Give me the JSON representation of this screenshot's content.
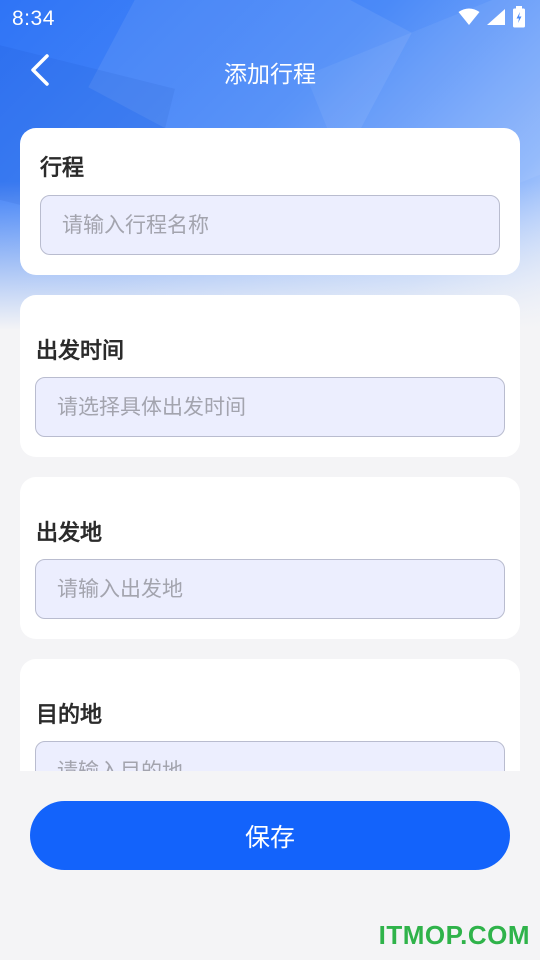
{
  "status_bar": {
    "time": "8:34"
  },
  "header": {
    "title": "添加行程",
    "back_icon": "chevron-left-icon"
  },
  "form": {
    "trip": {
      "label": "行程",
      "placeholder": "请输入行程名称",
      "value": ""
    },
    "departure_time": {
      "label": "出发时间",
      "placeholder": "请选择具体出发时间",
      "value": ""
    },
    "origin": {
      "label": "出发地",
      "placeholder": "请输入出发地",
      "value": ""
    },
    "destination": {
      "label": "目的地",
      "placeholder": "请输入目的地",
      "value": ""
    }
  },
  "actions": {
    "save_label": "保存"
  },
  "watermark": "ITMOP.COM",
  "colors": {
    "primary": "#1363fb",
    "field_bg": "#eceefe",
    "page_bg": "#f4f4f6",
    "watermark": "#2fb34a"
  }
}
